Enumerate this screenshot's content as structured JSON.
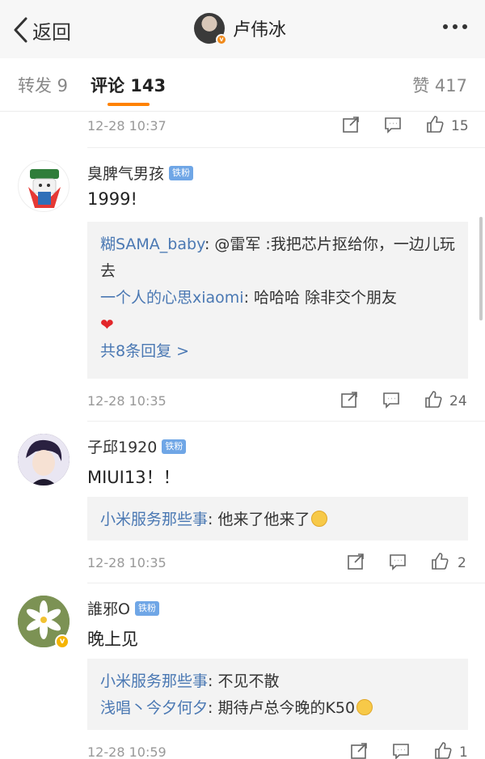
{
  "nav": {
    "back_label": "返回",
    "title": "卢伟冰",
    "badge": "v"
  },
  "tabs": {
    "repost": "转发 9",
    "comments": "评论 143",
    "likes": "赞 417"
  },
  "colors": {
    "accent": "#ff8200",
    "link": "#4a78b3",
    "fan_badge": "#6fa6e6"
  },
  "comments": [
    {
      "time": "12-28 10:37",
      "likes": "15"
    },
    {
      "user": "臭脾气男孩",
      "badge": "铁粉",
      "text": "1999!",
      "replies": [
        {
          "name": "糊SAMA_baby",
          "text": ": @雷军 :我把芯片抠给你，一边儿玩去"
        },
        {
          "name": "一个人的心思xiaomi",
          "text": ": 哈哈哈  除非交个朋友"
        }
      ],
      "more_replies": "共8条回复 >",
      "time": "12-28 10:35",
      "likes": "24"
    },
    {
      "user": "子邱1920",
      "badge": "铁粉",
      "text": "MIUI13！！",
      "replies": [
        {
          "name": "小米服务那些事",
          "text": ": 他来了他来了"
        }
      ],
      "time": "12-28 10:35",
      "likes": "2"
    },
    {
      "user": "誰邪O",
      "badge": "铁粉",
      "text": "晚上见",
      "replies": [
        {
          "name": "小米服务那些事",
          "text": ": 不见不散"
        },
        {
          "name": "浅唱丶今夕何夕",
          "text": ": 期待卢总今晚的K50"
        }
      ],
      "time": "12-28 10:59",
      "likes": "1"
    }
  ],
  "icons": [
    "back-chevron-icon",
    "more-dots-icon",
    "share-icon",
    "comment-icon",
    "thumbs-up-icon",
    "heart-icon",
    "verified-icon"
  ]
}
